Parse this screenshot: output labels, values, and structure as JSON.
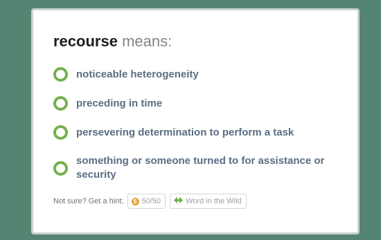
{
  "question": {
    "word": "recourse",
    "suffix": " means:"
  },
  "choices": [
    {
      "label": "noticeable heterogeneity"
    },
    {
      "label": "preceding in time"
    },
    {
      "label": "persevering determination to perform a task"
    },
    {
      "label": "something or someone turned to for assistance or security"
    }
  ],
  "hint": {
    "prompt": "Not sure? Get a hint:",
    "fifty_fifty_label": "50/50",
    "word_in_wild_label": "Word in the Wild"
  },
  "colors": {
    "background": "#568472",
    "radio_ring": "#74b04d",
    "choice_text": "#5a6d83",
    "coin": "#e2a43a",
    "wild_arrows": "#6fb14d"
  },
  "icons": {
    "coin": "coin-icon",
    "wild": "double-arrow-icon"
  }
}
